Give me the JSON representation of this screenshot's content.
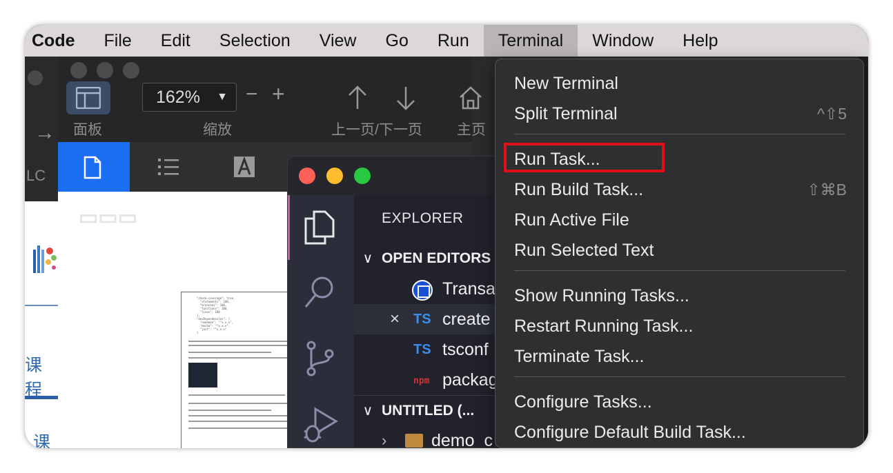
{
  "menubar": {
    "app_name": "Code",
    "items": [
      "File",
      "Edit",
      "Selection",
      "View",
      "Go",
      "Run",
      "Terminal",
      "Window",
      "Help"
    ],
    "active": "Terminal"
  },
  "left_app": {
    "arrow": "→",
    "fragment_lc": "LC",
    "fragment_course1": "课程",
    "fragment_course2": "课程"
  },
  "reader": {
    "panel_label": "面板",
    "zoom_value": "162%",
    "zoom_label": "缩放",
    "pager_label": "上一页/下一页",
    "home_label": "主页",
    "zoom_out": "−",
    "zoom_in": "+"
  },
  "vscode": {
    "explorer_title": "EXPLORER",
    "open_editors_label": "OPEN EDITORS",
    "open_files": [
      {
        "name": "Transa",
        "icon": "circle-app-icon"
      },
      {
        "name": "create",
        "icon": "TS",
        "close": "×"
      },
      {
        "name": "tsconf",
        "icon": "TS"
      },
      {
        "name": "packag",
        "icon": "npm"
      }
    ],
    "untitled_label": "UNTITLED (...",
    "folder_name": "demo_c"
  },
  "terminal_menu": {
    "groups": [
      [
        {
          "label": "New Terminal",
          "shortcut": ""
        },
        {
          "label": "Split Terminal",
          "shortcut": "^⇧5"
        }
      ],
      [
        {
          "label": "Run Task...",
          "shortcut": ""
        },
        {
          "label": "Run Build Task...",
          "shortcut": "⇧⌘B"
        },
        {
          "label": "Run Active File",
          "shortcut": ""
        },
        {
          "label": "Run Selected Text",
          "shortcut": ""
        }
      ],
      [
        {
          "label": "Show Running Tasks...",
          "shortcut": ""
        },
        {
          "label": "Restart Running Task...",
          "shortcut": ""
        },
        {
          "label": "Terminate Task...",
          "shortcut": ""
        }
      ],
      [
        {
          "label": "Configure Tasks...",
          "shortcut": ""
        },
        {
          "label": "Configure Default Build Task...",
          "shortcut": ""
        }
      ]
    ],
    "highlighted": "Run Task..."
  },
  "colors": {
    "highlight_box": "#e0101a",
    "menu_bg": "#2f2f31",
    "menubar_bg": "#dcd8d8",
    "reader_active_tab": "#1b6ef3"
  }
}
